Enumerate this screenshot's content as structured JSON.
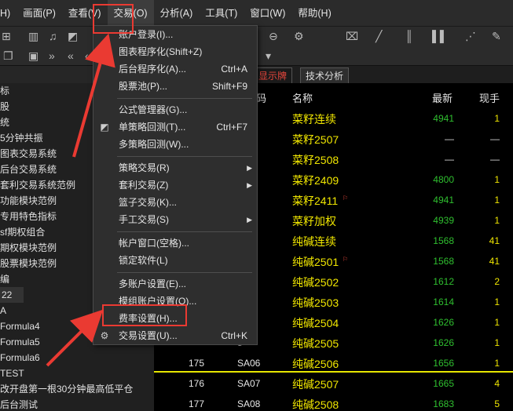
{
  "menubar": [
    {
      "label": "H)"
    },
    {
      "label": "画面(P)"
    },
    {
      "label": "查看(V)"
    },
    {
      "label": "交易(O)",
      "active": true
    },
    {
      "label": "分析(A)"
    },
    {
      "label": "工具(T)"
    },
    {
      "label": "窗口(W)"
    },
    {
      "label": "帮助(H)"
    }
  ],
  "tabs": [
    {
      "label": "显示牌",
      "style": "red"
    },
    {
      "label": "技术分析",
      "style": "normal"
    }
  ],
  "left_panel": [
    {
      "label": "标"
    },
    {
      "label": "股"
    },
    {
      "label": "统"
    },
    {
      "label": "5分钟共振"
    },
    {
      "label": "图表交易系统"
    },
    {
      "label": "后台交易系统"
    },
    {
      "label": "套利交易系统范例"
    },
    {
      "label": "功能模块范例"
    },
    {
      "label": "专用特色指标"
    },
    {
      "label": "sf期权组合"
    },
    {
      "label": "期权模块范例"
    },
    {
      "label": "股票模块范例"
    },
    {
      "label": "编"
    },
    {
      "label": "22",
      "highlight": true
    },
    {
      "label": "A"
    },
    {
      "label": "Formula4"
    },
    {
      "label": "Formula5"
    },
    {
      "label": "Formula6"
    },
    {
      "label": "TEST"
    },
    {
      "label": "改开盘第一根30分钟最高低平仓"
    },
    {
      "label": "后台测试"
    }
  ],
  "table": {
    "headers": {
      "name": "名称",
      "last": "最新",
      "hand": "现手"
    },
    "header_fragment": "码",
    "rows": [
      {
        "seq": "",
        "code": "0",
        "name": "菜籽连续",
        "last": "4941",
        "hand": "1"
      },
      {
        "seq": "",
        "code": "7",
        "name": "菜籽2507",
        "last": "—",
        "hand": "—"
      },
      {
        "seq": "",
        "code": "8",
        "name": "菜籽2508",
        "last": "—",
        "hand": "—"
      },
      {
        "seq": "",
        "code": "9",
        "name": "菜籽2409",
        "last": "4800",
        "hand": "1"
      },
      {
        "seq": "",
        "code": "1",
        "name": "菜籽2411",
        "last": "4941",
        "hand": "1",
        "flag": true
      },
      {
        "seq": "",
        "code": "0",
        "name": "菜籽加权",
        "last": "4939",
        "hand": "1"
      },
      {
        "seq": "",
        "code": "0",
        "name": "纯碱连续",
        "last": "1568",
        "hand": "41"
      },
      {
        "seq": "",
        "code": "1",
        "name": "纯碱2501",
        "last": "1568",
        "hand": "41",
        "flag": true
      },
      {
        "seq": "",
        "code": "2",
        "name": "纯碱2502",
        "last": "1612",
        "hand": "2"
      },
      {
        "seq": "",
        "code": "3",
        "name": "纯碱2503",
        "last": "1614",
        "hand": "1"
      },
      {
        "seq": "",
        "code": "4",
        "name": "纯碱2504",
        "last": "1626",
        "hand": "1"
      },
      {
        "seq": "",
        "code": "5",
        "name": "纯碱2505",
        "last": "1626",
        "hand": "1"
      },
      {
        "seq": "175",
        "code": "SA06",
        "name": "纯碱2506",
        "last": "1656",
        "hand": "1"
      },
      {
        "seq": "176",
        "code": "SA07",
        "name": "纯碱2507",
        "last": "1665",
        "hand": "4"
      },
      {
        "seq": "177",
        "code": "SA08",
        "name": "纯碱2508",
        "last": "1683",
        "hand": "5"
      }
    ]
  },
  "dropdown": {
    "items": [
      {
        "label": "账户登录(I)...",
        "shortcut": "",
        "icon": "",
        "submenu": false
      },
      {
        "label": "图表程序化(Shift+Z)",
        "shortcut": "",
        "icon": "",
        "submenu": false
      },
      {
        "label": "后台程序化(A)...",
        "shortcut": "Ctrl+A",
        "icon": "",
        "submenu": false
      },
      {
        "label": "股票池(P)...",
        "shortcut": "Shift+F9",
        "icon": "",
        "submenu": false
      },
      {
        "sep": true
      },
      {
        "label": "公式管理器(G)...",
        "shortcut": "",
        "icon": "",
        "submenu": false
      },
      {
        "label": "单策略回测(T)...",
        "shortcut": "Ctrl+F7",
        "icon": "chart-icon",
        "submenu": false
      },
      {
        "label": "多策略回测(W)...",
        "shortcut": "",
        "icon": "",
        "submenu": false
      },
      {
        "sep": true
      },
      {
        "label": "策略交易(R)",
        "shortcut": "",
        "icon": "",
        "submenu": true
      },
      {
        "label": "套利交易(Z)",
        "shortcut": "",
        "icon": "",
        "submenu": true
      },
      {
        "label": "篮子交易(K)...",
        "shortcut": "",
        "icon": "",
        "submenu": false
      },
      {
        "label": "手工交易(S)",
        "shortcut": "",
        "icon": "",
        "submenu": true
      },
      {
        "sep": true
      },
      {
        "label": "帐户窗口(空格)...",
        "shortcut": "",
        "icon": "",
        "submenu": false
      },
      {
        "label": "锁定软件(L)",
        "shortcut": "",
        "icon": "",
        "submenu": false
      },
      {
        "sep": true
      },
      {
        "label": "多账户设置(E)...",
        "shortcut": "",
        "icon": "",
        "submenu": false
      },
      {
        "label": "模组账户设置(O)...",
        "shortcut": "",
        "icon": "",
        "submenu": false
      },
      {
        "label": "费率设置(H)...",
        "shortcut": "",
        "icon": "",
        "submenu": false,
        "boxed": true
      },
      {
        "label": "交易设置(U)...",
        "shortcut": "Ctrl+K",
        "icon": "gear-icon",
        "submenu": false
      }
    ]
  },
  "colors": {
    "annotation_red": "#ea3a32",
    "name_yellow": "#f0e600",
    "price_green": "#2fbf2f"
  }
}
